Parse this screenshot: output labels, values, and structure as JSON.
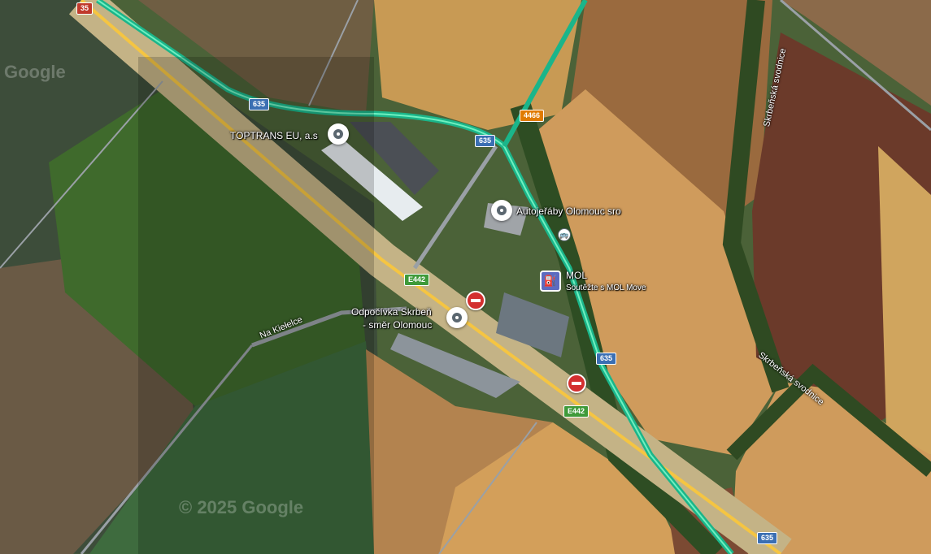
{
  "map": {
    "watermarks": [
      "Google",
      "© 2025 Google"
    ],
    "shields": {
      "r35": "35",
      "r635_a": "635",
      "r635_b": "635",
      "r635_c": "635",
      "r635_d": "635",
      "r4466": "4466",
      "e442_a": "E442",
      "e442_b": "E442"
    },
    "places": {
      "toptrans": "TOPTRANS EU, a.s",
      "autojeraby": "Autojeřáby Olomouc sro",
      "mol": "MOL",
      "mol_sub": "Soutěžte s MOL Move",
      "odpocivka_1": "Odpočívka Skrbeň",
      "odpocivka_2": "- směr Olomouc"
    },
    "roads": {
      "na_kierelce": "Na Kiełelce",
      "skrbenska_1": "Skrbeňská svodnice",
      "skrbenska_2": "Skrbeňská svodnice"
    },
    "icons": {
      "fuel": "⛽",
      "bus": "🚌"
    }
  }
}
